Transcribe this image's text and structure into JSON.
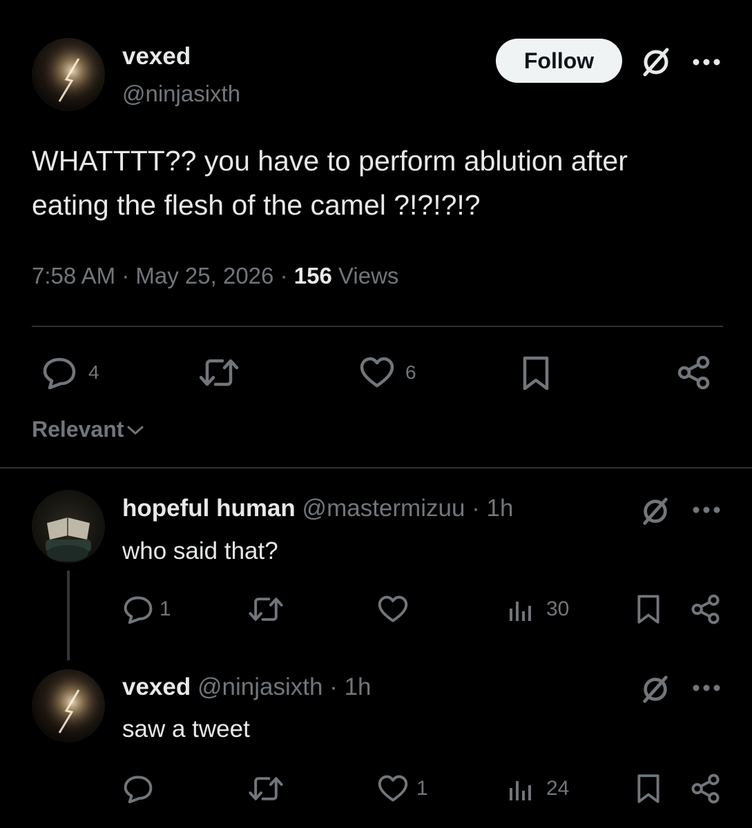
{
  "main_tweet": {
    "author_name": "vexed",
    "author_handle": "@ninjasixth",
    "follow_label": "Follow",
    "text_line1": "WHATTTT?? you have to perform ablution after",
    "text_line2": "eating the flesh of the camel ?!?!?!?",
    "time": "7:58 AM",
    "date": "May 25, 2026",
    "views_count": "156",
    "views_label": "Views",
    "actions": {
      "reply_count": "4",
      "like_count": "6"
    }
  },
  "sort": {
    "label": "Relevant"
  },
  "replies": [
    {
      "name": "hopeful human",
      "handle": "@mastermizuu",
      "age": "1h",
      "text": "who said that?",
      "reply_count": "1",
      "like_count": "",
      "views": "30"
    },
    {
      "name": "vexed",
      "handle": "@ninjasixth",
      "age": "1h",
      "text": "saw a tweet",
      "reply_count": "",
      "like_count": "1",
      "views": "24"
    }
  ],
  "separator": "·",
  "colors": {
    "background": "#000000",
    "text": "#e7e9ea",
    "secondary": "#71767b",
    "divider": "#2f3336",
    "follow_bg": "#eff3f4"
  },
  "icons": [
    "grok-icon",
    "more-icon",
    "reply-icon",
    "retweet-icon",
    "like-icon",
    "bookmark-icon",
    "share-icon",
    "views-icon",
    "chevron-down-icon"
  ]
}
